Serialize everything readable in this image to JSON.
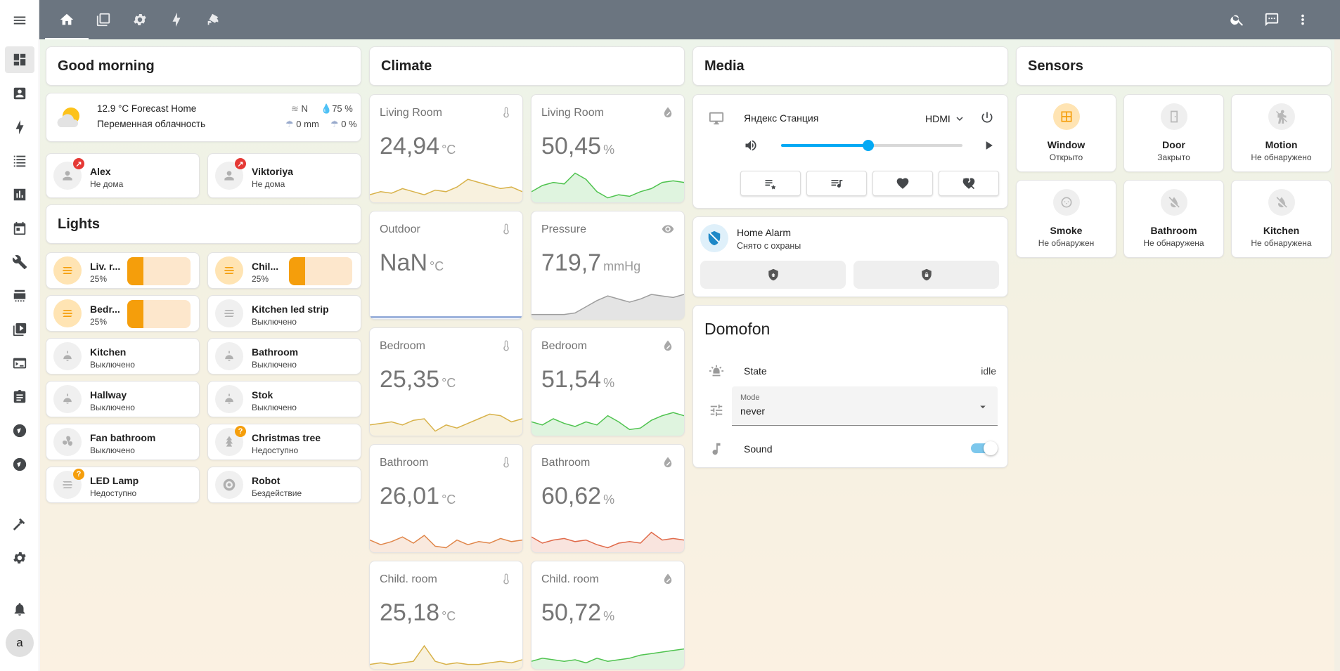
{
  "topbar": {
    "tabs": [
      "home-icon",
      "areas-icon",
      "settings-icon",
      "energy-icon",
      "cctv-icon"
    ]
  },
  "greeting": {
    "title": "Good morning"
  },
  "weather": {
    "temperature": "12.9 °C Forecast Home",
    "condition": "Переменная облачность",
    "wind": "N",
    "humidity": "75 %",
    "precipitation": "0 mm",
    "precip_probability": "0 %"
  },
  "persons": [
    {
      "name": "Alex",
      "state": "Не дома"
    },
    {
      "name": "Viktoriya",
      "state": "Не дома"
    }
  ],
  "lights": {
    "title": "Lights",
    "items": [
      {
        "name": "Liv. r...",
        "state": "25%",
        "brightness": 25,
        "on": true
      },
      {
        "name": "Chil...",
        "state": "25%",
        "brightness": 25,
        "on": true
      },
      {
        "name": "Bedr...",
        "state": "25%",
        "brightness": 25,
        "on": true
      },
      {
        "name": "Kitchen led strip",
        "state": "Выключено"
      },
      {
        "name": "Kitchen",
        "state": "Выключено"
      },
      {
        "name": "Bathroom",
        "state": "Выключено"
      },
      {
        "name": "Hallway",
        "state": "Выключено"
      },
      {
        "name": "Stok",
        "state": "Выключено"
      },
      {
        "name": "Fan bathroom",
        "state": "Выключено"
      },
      {
        "name": "Christmas tree",
        "state": "Недоступно",
        "badge": "?"
      },
      {
        "name": "LED Lamp",
        "state": "Недоступно",
        "badge": "?"
      },
      {
        "name": "Robot",
        "state": "Бездействие"
      }
    ]
  },
  "climate": {
    "title": "Climate",
    "sensors": [
      {
        "name": "Living Room",
        "value": "24,94",
        "unit": "°C",
        "kind": "temp"
      },
      {
        "name": "Living Room",
        "value": "50,45",
        "unit": "%",
        "kind": "hum"
      },
      {
        "name": "Outdoor",
        "value": "NaN",
        "unit": "°C",
        "kind": "temp"
      },
      {
        "name": "Pressure",
        "value": "719,7",
        "unit": "mmHg",
        "kind": "eye"
      },
      {
        "name": "Bedroom",
        "value": "25,35",
        "unit": "°C",
        "kind": "temp"
      },
      {
        "name": "Bedroom",
        "value": "51,54",
        "unit": "%",
        "kind": "hum"
      },
      {
        "name": "Bathroom",
        "value": "26,01",
        "unit": "°C",
        "kind": "temp"
      },
      {
        "name": "Bathroom",
        "value": "60,62",
        "unit": "%",
        "kind": "hum"
      },
      {
        "name": "Child. room",
        "value": "25,18",
        "unit": "°C",
        "kind": "temp"
      },
      {
        "name": "Child. room",
        "value": "50,72",
        "unit": "%",
        "kind": "hum"
      }
    ]
  },
  "media": {
    "title": "Media",
    "player_name": "Яндекс Станция",
    "source": "HDMI",
    "volume": 0.48
  },
  "alarm": {
    "name": "Home Alarm",
    "state": "Снято с охраны"
  },
  "domofon": {
    "title": "Domofon",
    "state_label": "State",
    "state_value": "idle",
    "mode_label": "Mode",
    "mode_value": "never",
    "sound_label": "Sound",
    "sound_on": true
  },
  "sensors": {
    "title": "Sensors",
    "items": [
      {
        "name": "Window",
        "state": "Открыто",
        "active": true
      },
      {
        "name": "Door",
        "state": "Закрыто"
      },
      {
        "name": "Motion",
        "state": "Не обнаружено"
      },
      {
        "name": "Smoke",
        "state": "Не обнаружен"
      },
      {
        "name": "Bathroom",
        "state": "Не обнаружена"
      },
      {
        "name": "Kitchen",
        "state": "Не обнаружена"
      }
    ]
  },
  "sidebar": {
    "avatar_letter": "a"
  }
}
